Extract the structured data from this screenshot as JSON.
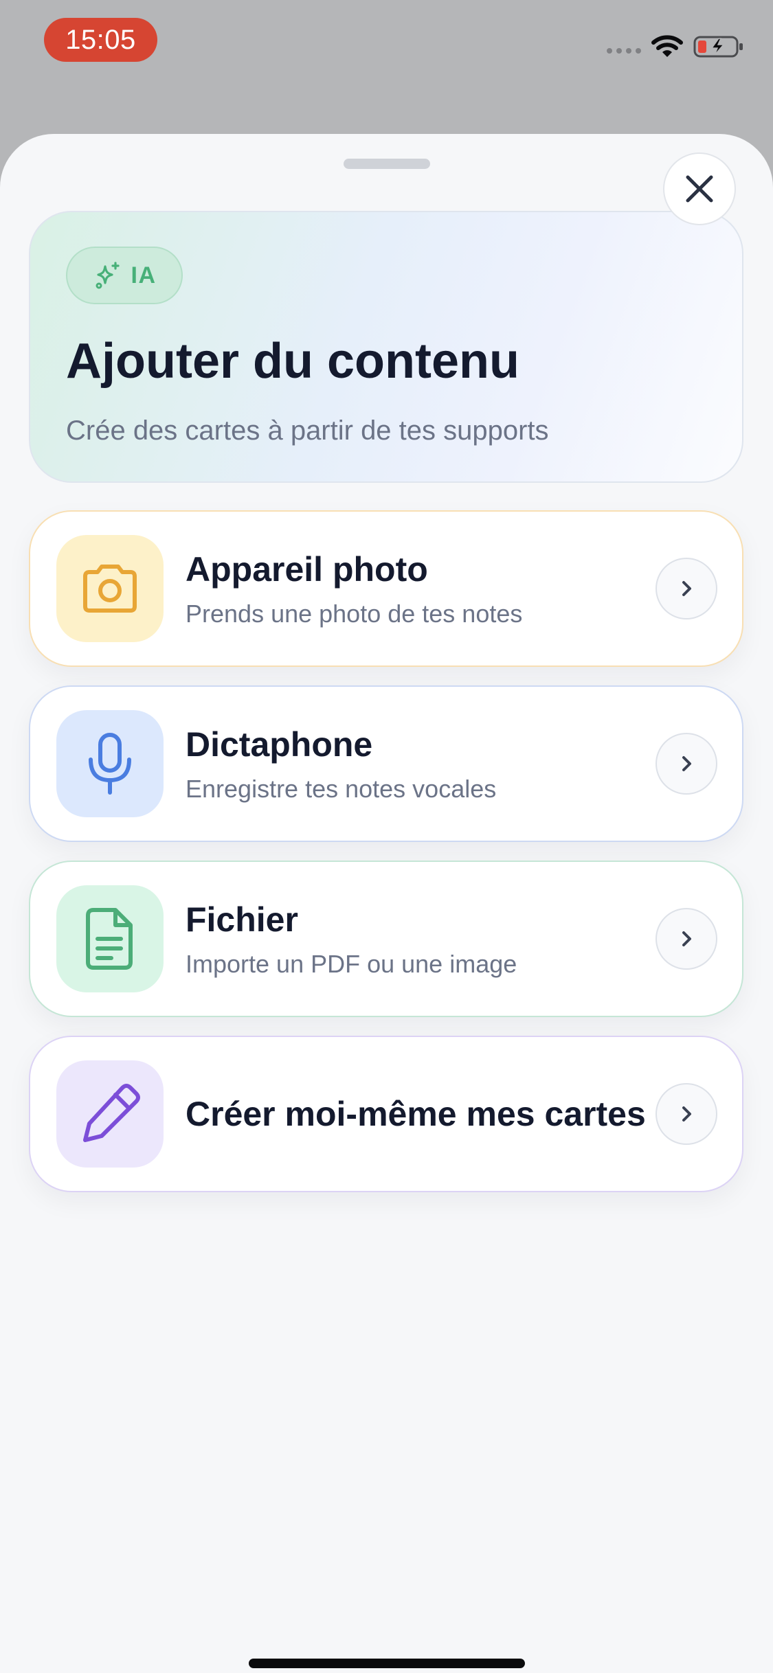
{
  "status_bar": {
    "time": "15:05",
    "wifi_icon": "wifi-icon",
    "battery_icon": "battery-charging-icon",
    "colors": {
      "time_pill": "#d64532",
      "battery_low": "#e5473a"
    }
  },
  "header": {
    "badge_label": "IA",
    "badge_icon": "sparkles-icon",
    "title": "Ajouter du contenu",
    "subtitle": "Crée des cartes à partir de tes supports",
    "close_icon": "close-icon"
  },
  "options": [
    {
      "title": "Appareil photo",
      "description": "Prends une photo de tes notes",
      "icon": "camera-icon",
      "accent": "#e8a636"
    },
    {
      "title": "Dictaphone",
      "description": "Enregistre tes notes vocales",
      "icon": "microphone-icon",
      "accent": "#4a7de0"
    },
    {
      "title": "Fichier",
      "description": "Importe un PDF ou une image",
      "icon": "document-icon",
      "accent": "#4cad78"
    },
    {
      "title": "Créer moi-même mes cartes",
      "description": "",
      "icon": "pencil-icon",
      "accent": "#7c4ed8"
    }
  ],
  "chevron_icon": "chevron-right-icon"
}
